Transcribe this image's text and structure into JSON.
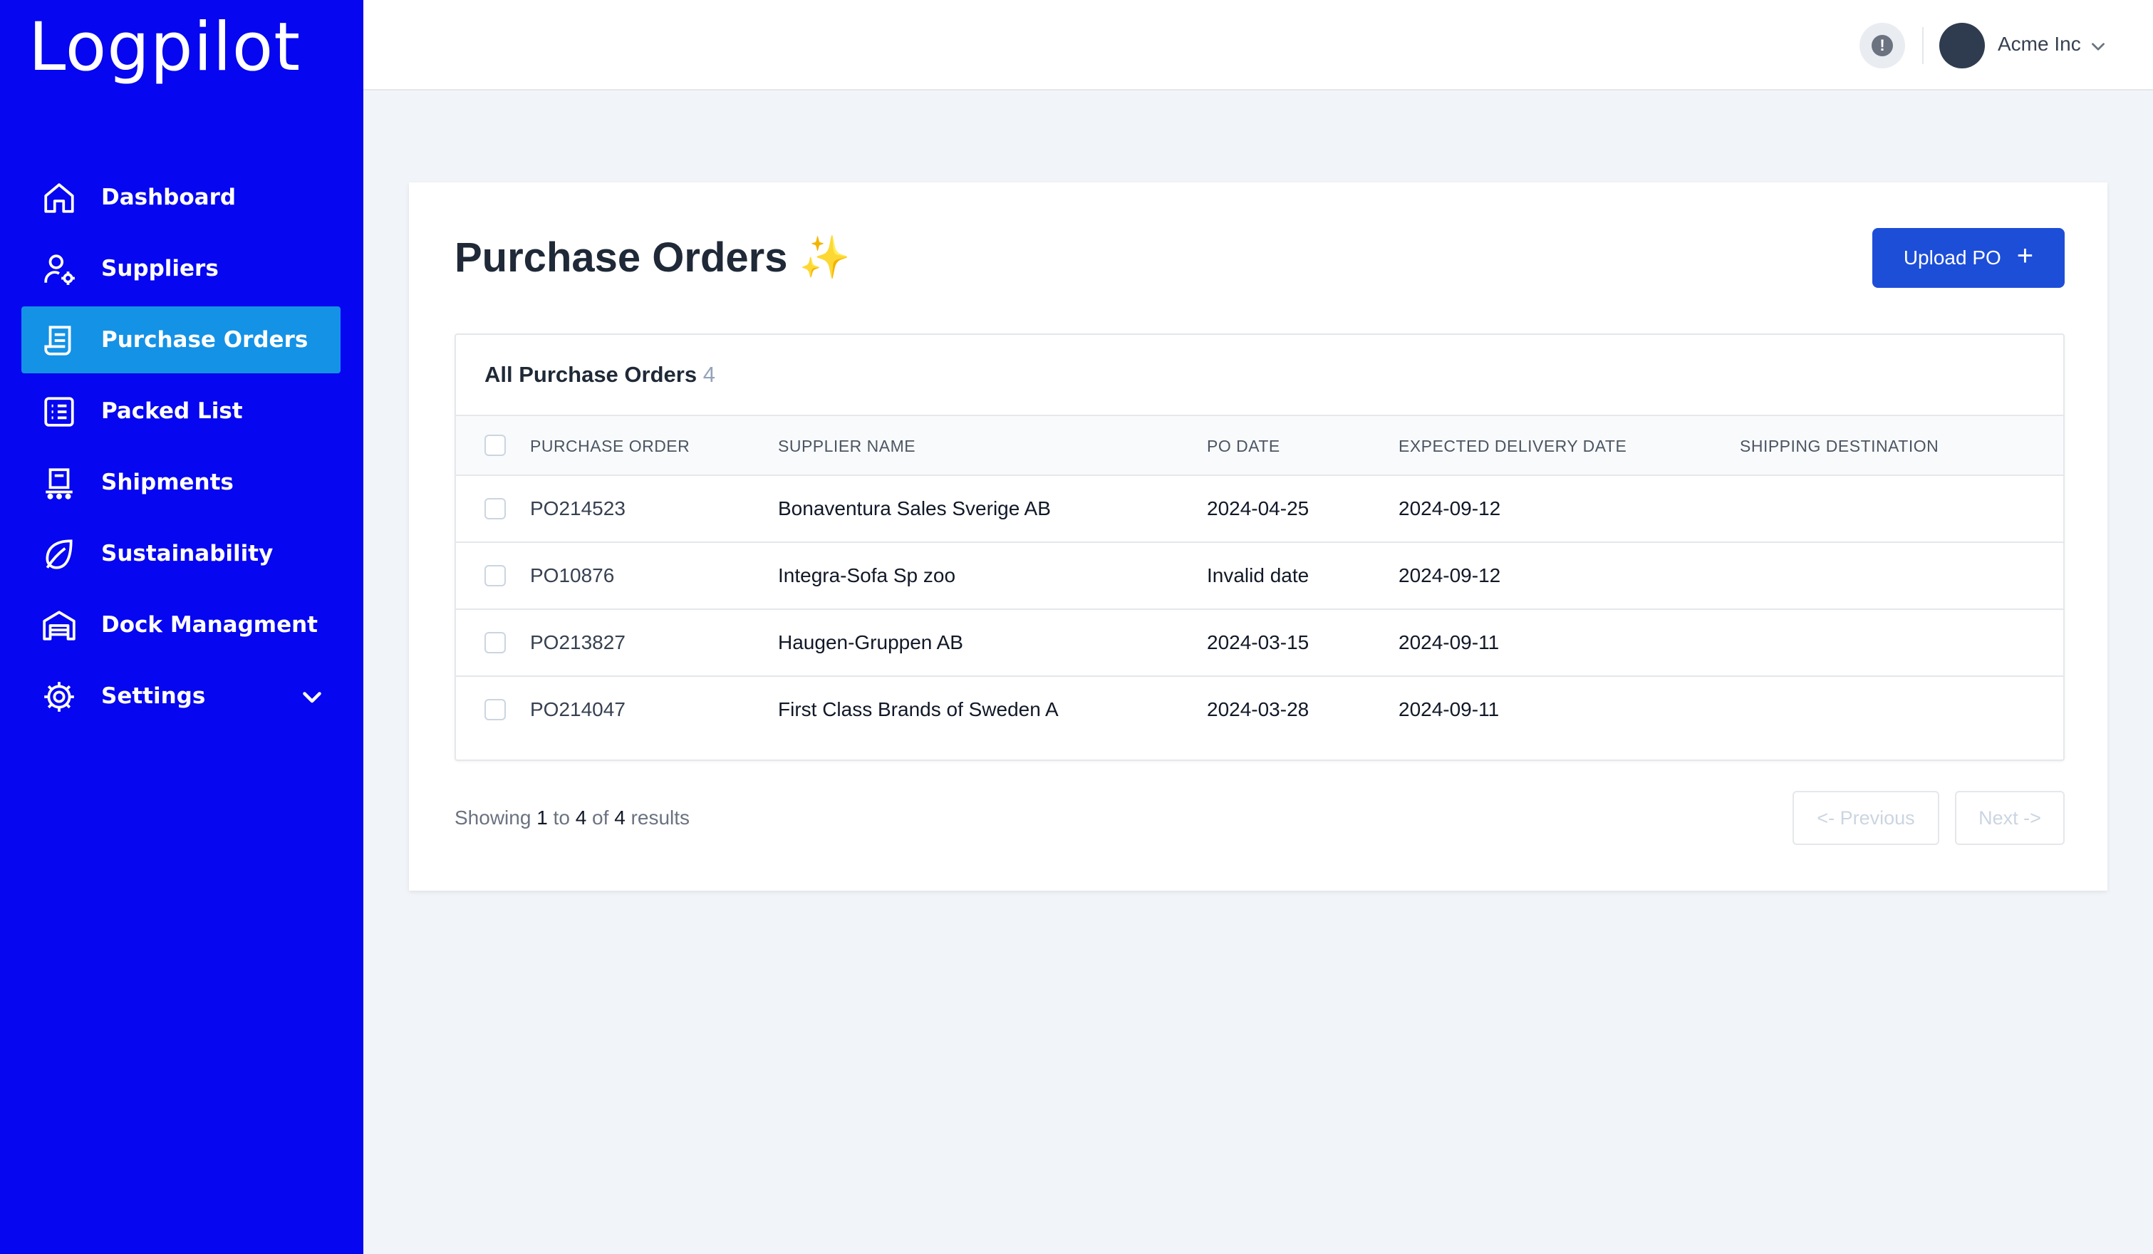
{
  "app": {
    "logo": "Logpilot"
  },
  "sidebar": {
    "items": [
      {
        "label": "Dashboard",
        "icon": "home-icon"
      },
      {
        "label": "Suppliers",
        "icon": "user-gear-icon"
      },
      {
        "label": "Purchase Orders",
        "icon": "receipt-icon",
        "active": true
      },
      {
        "label": "Packed List",
        "icon": "list-icon"
      },
      {
        "label": "Shipments",
        "icon": "cart-icon"
      },
      {
        "label": "Sustainability",
        "icon": "leaf-icon"
      },
      {
        "label": "Dock Managment",
        "icon": "warehouse-icon"
      },
      {
        "label": "Settings",
        "icon": "gear-icon",
        "expandable": true
      }
    ]
  },
  "topbar": {
    "alert_glyph": "!",
    "account_name": "Acme Inc"
  },
  "main": {
    "title": "Purchase Orders",
    "title_emoji": "✨",
    "upload_label": "Upload PO",
    "upload_icon": "+",
    "table": {
      "caption": "All Purchase Orders",
      "count": "4",
      "columns": [
        "PURCHASE ORDER",
        "SUPPLIER NAME",
        "PO DATE",
        "EXPECTED DELIVERY DATE",
        "SHIPPING DESTINATION"
      ],
      "rows": [
        {
          "po": "PO214523",
          "supplier": "Bonaventura Sales Sverige AB",
          "po_date": "2024-04-25",
          "delivery": "2024-09-12",
          "destination": ""
        },
        {
          "po": "PO10876",
          "supplier": "Integra-Sofa Sp zoo",
          "po_date": "Invalid date",
          "delivery": "2024-09-12",
          "destination": ""
        },
        {
          "po": "PO213827",
          "supplier": "Haugen-Gruppen AB",
          "po_date": "2024-03-15",
          "delivery": "2024-09-11",
          "destination": ""
        },
        {
          "po": "PO214047",
          "supplier": "First Class Brands of Sweden A",
          "po_date": "2024-03-28",
          "delivery": "2024-09-11",
          "destination": ""
        }
      ]
    },
    "pagination": {
      "showing": "Showing",
      "from": "1",
      "to_word": "to",
      "to": "4",
      "of_word": "of",
      "total": "4",
      "results_word": "results",
      "prev_label": "<- Previous",
      "next_label": "Next ->"
    }
  },
  "colors": {
    "sidebar_bg": "#0606f0",
    "active_item": "#1492e6",
    "primary_button": "#1d4ed8"
  }
}
